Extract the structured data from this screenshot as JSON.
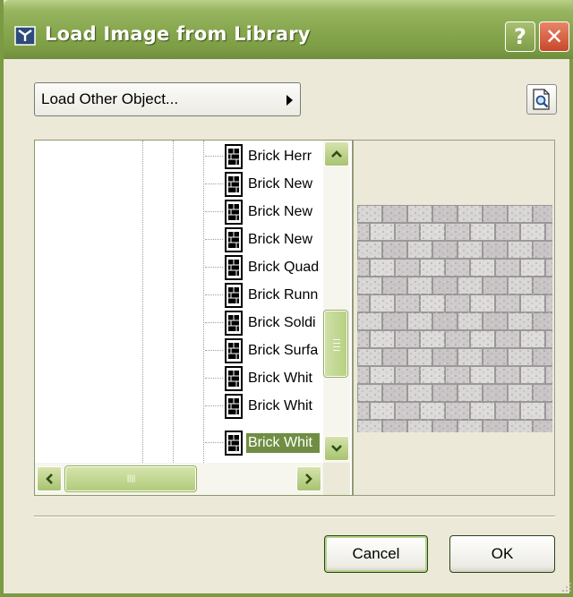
{
  "window": {
    "title": "Load Image from Library",
    "help_glyph": "?",
    "close_glyph": "✕"
  },
  "toolbar": {
    "load_other_label": "Load Other Object...",
    "preview_icon": "magnifier-page-icon"
  },
  "tree": {
    "items": [
      {
        "label": "Brick Herr",
        "selected": false
      },
      {
        "label": "Brick New",
        "selected": false
      },
      {
        "label": "Brick New",
        "selected": false
      },
      {
        "label": "Brick New",
        "selected": false
      },
      {
        "label": "Brick Quad",
        "selected": false
      },
      {
        "label": "Brick Runn",
        "selected": false
      },
      {
        "label": "Brick Soldi",
        "selected": false
      },
      {
        "label": "Brick Surfa",
        "selected": false
      },
      {
        "label": "Brick Whit",
        "selected": false
      },
      {
        "label": "Brick Whit",
        "selected": false
      },
      {
        "label": "Brick Whit",
        "selected": true
      }
    ],
    "hscroll_grip": "IIII"
  },
  "buttons": {
    "cancel": "Cancel",
    "ok": "OK"
  },
  "colors": {
    "titlebar": "#88a84f",
    "selection": "#6f8e43",
    "dialog_bg": "#ece9d8"
  }
}
